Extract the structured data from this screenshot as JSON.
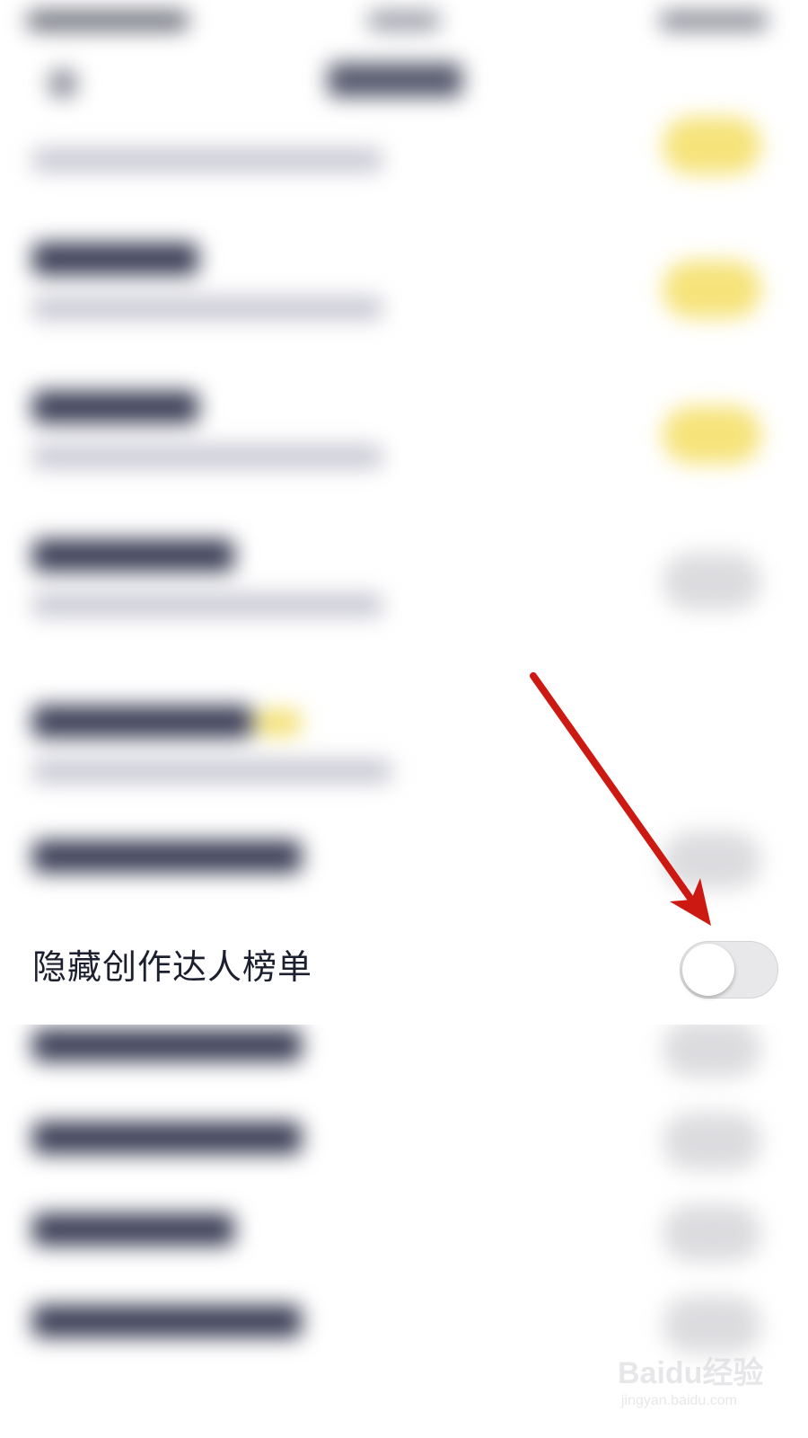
{
  "setting_row": {
    "label": "隐藏创作达人榜单",
    "toggle_on": false
  },
  "colors": {
    "toggle_off_track": "#e8e8ea",
    "arrow": "#cc1a12",
    "text": "#1c1f2e"
  },
  "watermark": {
    "main": "Baidu经验",
    "sub": "jingyan.baidu.com"
  }
}
